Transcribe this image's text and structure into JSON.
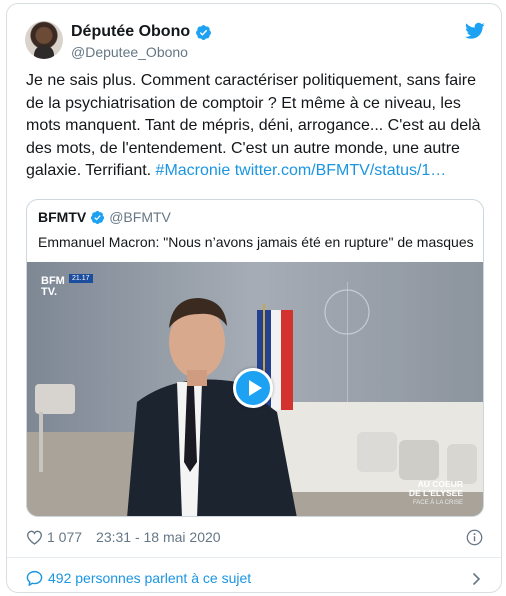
{
  "author": {
    "display_name": "Députée Obono",
    "handle": "@Deputee_Obono",
    "verified_icon": "verified-badge-icon",
    "avatar_icon": "avatar"
  },
  "brand_icon": "twitter-bird-icon",
  "tweet": {
    "text": "Je ne sais plus. Comment caractériser politiquement, sans faire de la psychiatrisation de comptoir ? Et même à ce niveau, les mots manquent. Tant de mépris, déni, arrogance... C'est au delà des mots, de l'entendement. C'est un autre monde, une autre galaxie. Terrifiant. ",
    "hashtag": "#Macronie",
    "link": "twitter.com/BFMTV/status/1…"
  },
  "quoted_tweet": {
    "name": "BFMTV",
    "handle": "@BFMTV",
    "text": "Emmanuel Macron: \"Nous n’avons jamais été en rupture\" de masques",
    "video": {
      "channel_logo_line1": "BFM",
      "channel_logo_line2": "TV.",
      "time_badge": "21.17",
      "overlay_line1": "AU COEUR",
      "overlay_line2": "DE L'ELYSEE",
      "overlay_sub": "FACE À LA CRISE",
      "play_icon": "play-icon"
    }
  },
  "meta": {
    "likes": "1 077",
    "timestamp": "23:31 - 18 mai 2020",
    "heart_icon": "heart-icon",
    "info_icon": "info-icon"
  },
  "conversation": {
    "label": "492 personnes parlent à ce sujet",
    "bubble_icon": "chat-bubble-icon",
    "chevron_icon": "chevron-right-icon"
  },
  "colors": {
    "link": "#1b95e0",
    "verified": "#1da1f2",
    "text": "#14171a",
    "secondary": "#657786",
    "border": "#d9dee2"
  }
}
